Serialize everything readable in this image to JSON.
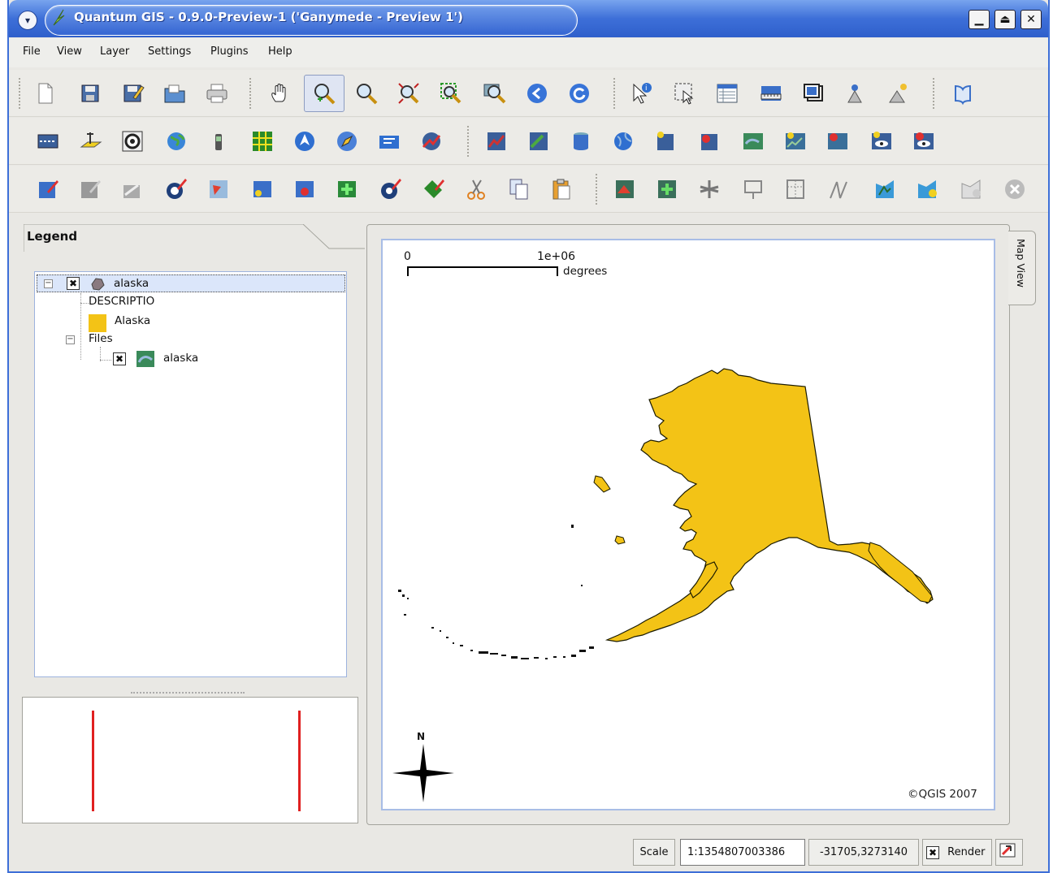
{
  "window": {
    "title": "Quantum GIS - 0.9.0-Preview-1 ('Ganymede - Preview 1')",
    "menu_button": "▾",
    "btn_minimize": "▁",
    "btn_maximize": "⏏",
    "btn_close": "✕"
  },
  "menubar": {
    "items": [
      "File",
      "View",
      "Layer",
      "Settings",
      "Plugins",
      "Help"
    ]
  },
  "legend": {
    "tab_label": "Legend",
    "layer_name": "alaska",
    "field_name": "DESCRIPTIO",
    "class_label": "Alaska",
    "class_color": "#f3c316",
    "files_label": "Files",
    "file_name": "alaska",
    "collapse_symbol": "⊟",
    "check_symbol": "✖"
  },
  "map": {
    "tab_label": "Map View",
    "scalebar_zero": "0",
    "scalebar_max": "1e+06",
    "scalebar_unit": "degrees",
    "north_label": "N",
    "copyright": "©QGIS 2007",
    "fill_color": "#f3c316"
  },
  "status": {
    "scale_label": "Scale",
    "scale_value": "1:1354807003386",
    "coordinates": "-31705,3273140",
    "render_label": "Render",
    "render_check": "✖"
  }
}
